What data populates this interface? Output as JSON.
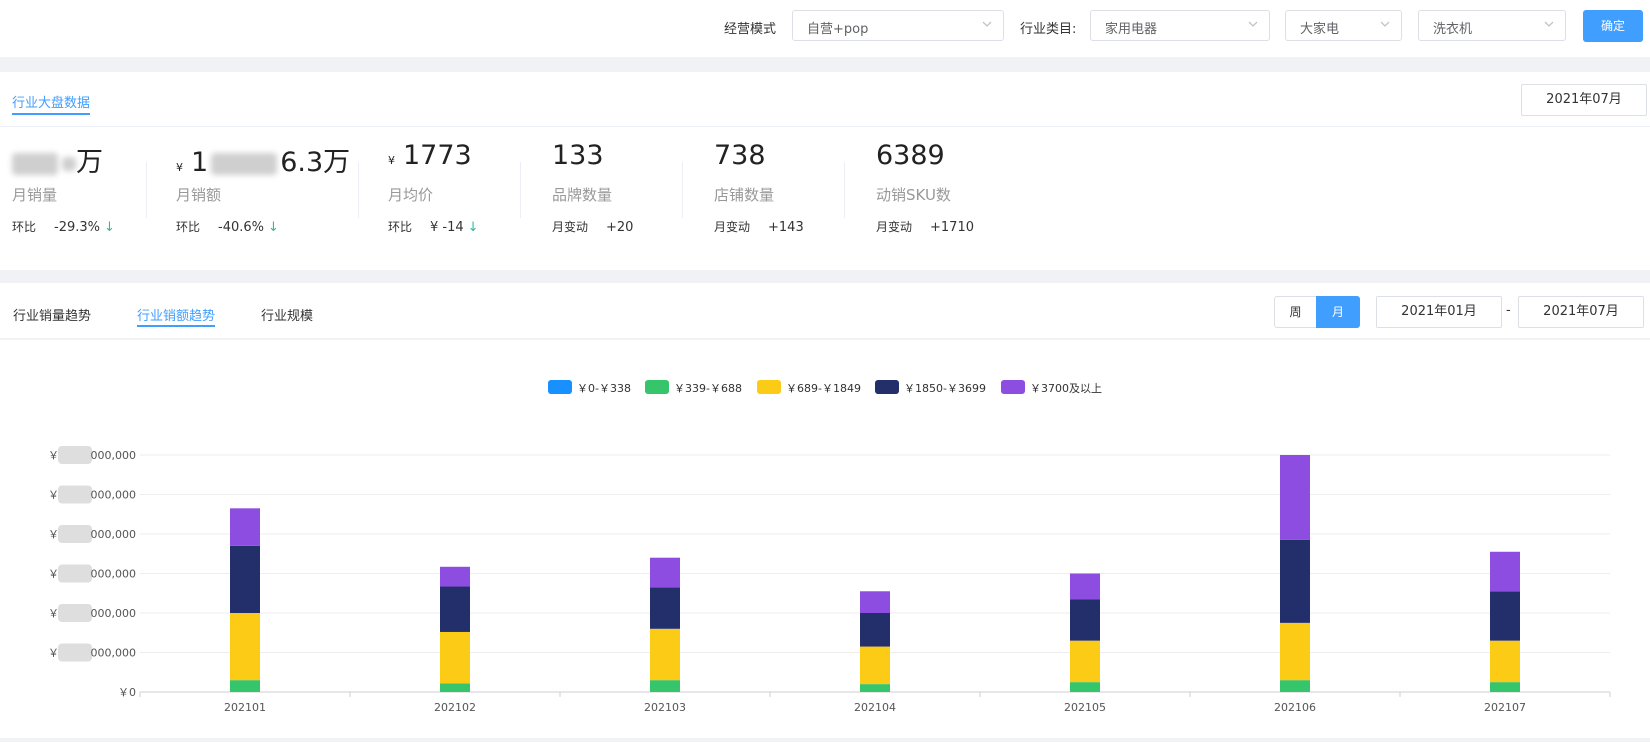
{
  "filters": {
    "mode_label": "经营模式",
    "mode_value": "自营+pop",
    "category_label": "行业类目:",
    "category_value": "家用电器",
    "sub_value": "大家电",
    "leaf_value": "洗衣机",
    "confirm_label": "确定"
  },
  "overview": {
    "title": "行业大盘数据",
    "month": "2021年07月",
    "stats": [
      {
        "value_suffix": "万",
        "label": "月销量",
        "sub_label": "环比",
        "sub_value": "-29.3%",
        "trend": "down"
      },
      {
        "currency": "¥",
        "value_prefix": "1",
        "value_suffix": "6.3万",
        "label": "月销额",
        "sub_label": "环比",
        "sub_value": "-40.6%",
        "trend": "down"
      },
      {
        "currency": "¥",
        "value": "1773",
        "label": "月均价",
        "sub_label": "环比",
        "sub_value": "¥ -14",
        "trend": "down"
      },
      {
        "value": "133",
        "label": "品牌数量",
        "sub_label": "月变动",
        "sub_value": "+20"
      },
      {
        "value": "738",
        "label": "店铺数量",
        "sub_label": "月变动",
        "sub_value": "+143"
      },
      {
        "value": "6389",
        "label": "动销SKU数",
        "sub_label": "月变动",
        "sub_value": "+1710"
      }
    ],
    "trend_arrow": "↓"
  },
  "trend": {
    "tabs": [
      "行业销量趋势",
      "行业销额趋势",
      "行业规模"
    ],
    "active_tab": 1,
    "granularity": [
      "周",
      "月"
    ],
    "active_granularity": 1,
    "range_start": "2021年01月",
    "range_sep": "-",
    "range_end": "2021年07月"
  },
  "chart_data": {
    "type": "bar",
    "stacked": true,
    "categories": [
      "202101",
      "202102",
      "202103",
      "202104",
      "202105",
      "202106",
      "202107"
    ],
    "series": [
      {
        "name": "￥0-￥338",
        "color": "#1890ff",
        "values": [
          0,
          0,
          0,
          0,
          0,
          0,
          0
        ]
      },
      {
        "name": "￥339-￥688",
        "color": "#36c56b",
        "values": [
          0.3,
          0.22,
          0.3,
          0.2,
          0.25,
          0.3,
          0.25
        ]
      },
      {
        "name": "￥689-￥1849",
        "color": "#fccb16",
        "values": [
          1.7,
          1.3,
          1.3,
          0.95,
          1.05,
          1.45,
          1.05
        ]
      },
      {
        "name": "￥1850-￥3699",
        "color": "#232f6b",
        "values": [
          1.7,
          1.15,
          1.05,
          0.85,
          1.05,
          2.1,
          1.25
        ]
      },
      {
        "name": "￥3700及以上",
        "color": "#8c4de0",
        "values": [
          0.95,
          0.5,
          0.75,
          0.55,
          0.65,
          2.15,
          1.0
        ]
      }
    ],
    "y_tick_labels": [
      "￥0",
      "￥",
      "￥",
      "￥",
      "￥",
      "￥",
      "￥"
    ],
    "y_tick_suffixes": [
      "",
      "000,000",
      "000,000",
      "000,000",
      "000,000",
      "000,000",
      "000,000"
    ],
    "ylim": [
      0,
      6
    ],
    "legend_position": "top-center",
    "grid": true
  }
}
